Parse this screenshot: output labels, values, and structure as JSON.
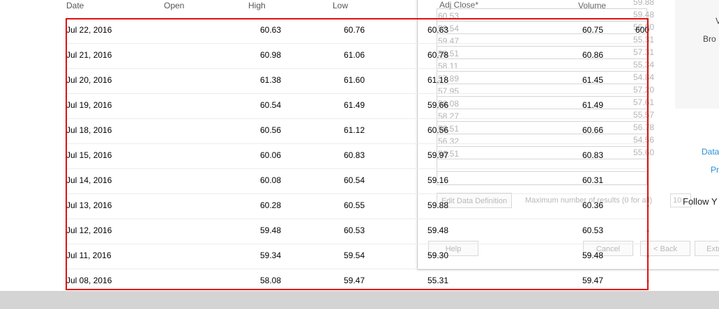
{
  "table": {
    "headers": {
      "date": "Date",
      "open": "Open",
      "high": "High",
      "low": "Low"
    },
    "rows": [
      {
        "date": "Jul 22, 2016",
        "open": "60.63",
        "high": "60.76",
        "low": "60.63",
        "adj": "60.75",
        "vol": "600"
      },
      {
        "date": "Jul 21, 2016",
        "open": "60.98",
        "high": "61.06",
        "low": "60.78",
        "adj": "60.86",
        "vol": ""
      },
      {
        "date": "Jul 20, 2016",
        "open": "61.38",
        "high": "61.60",
        "low": "61.18",
        "adj": "61.45",
        "vol": ""
      },
      {
        "date": "Jul 19, 2016",
        "open": "60.54",
        "high": "61.49",
        "low": "59.66",
        "adj": "61.49",
        "vol": ""
      },
      {
        "date": "Jul 18, 2016",
        "open": "60.56",
        "high": "61.12",
        "low": "60.56",
        "adj": "60.66",
        "vol": ""
      },
      {
        "date": "Jul 15, 2016",
        "open": "60.06",
        "high": "60.83",
        "low": "59.97",
        "adj": "60.83",
        "vol": ""
      },
      {
        "date": "Jul 14, 2016",
        "open": "60.08",
        "high": "60.54",
        "low": "59.16",
        "adj": "60.31",
        "vol": ""
      },
      {
        "date": "Jul 13, 2016",
        "open": "60.28",
        "high": "60.55",
        "low": "59.88",
        "adj": "60.36",
        "vol": "-"
      },
      {
        "date": "Jul 12, 2016",
        "open": "59.48",
        "high": "60.53",
        "low": "59.48",
        "adj": "60.53",
        "vol": "-"
      },
      {
        "date": "Jul 11, 2016",
        "open": "59.34",
        "high": "59.54",
        "low": "59.30",
        "adj": "59.48",
        "vol": "-"
      },
      {
        "date": "Jul 08, 2016",
        "open": "58.08",
        "high": "59.47",
        "low": "55.31",
        "adj": "59.47",
        "vol": "-"
      }
    ]
  },
  "dialog": {
    "adj_close_header": "Adj Close*",
    "volume_header": "Volume",
    "preview_values": [
      "60.53",
      "59.54",
      "59.47",
      "58.51",
      "58.11",
      "57.89",
      "57.95",
      "58.08",
      "58.27",
      "56.51",
      "56.32",
      "56.51"
    ],
    "right_values": [
      "59.88",
      "59.48",
      "56.00",
      "55.31",
      "57.31",
      "55.34",
      "54.84",
      "57.20",
      "57.61",
      "55.57",
      "56.78",
      "54.56",
      "55.60"
    ],
    "edit_button": "Edit Data Definition",
    "max_results_label": "Maximum number of results (0 for all)",
    "max_results_value": "10",
    "help_button": "Help",
    "cancel_button": "Cancel",
    "back_button": "< Back",
    "extract_button": "Extra"
  },
  "side": {
    "top_label": "W",
    "label_v": "V",
    "label_bro": "Bro",
    "link_data": "Data",
    "link_pr": "Pr",
    "follow_text": "Follow Y"
  },
  "colors": {
    "highlight": "#e01010",
    "link": "#2b8fd6"
  }
}
